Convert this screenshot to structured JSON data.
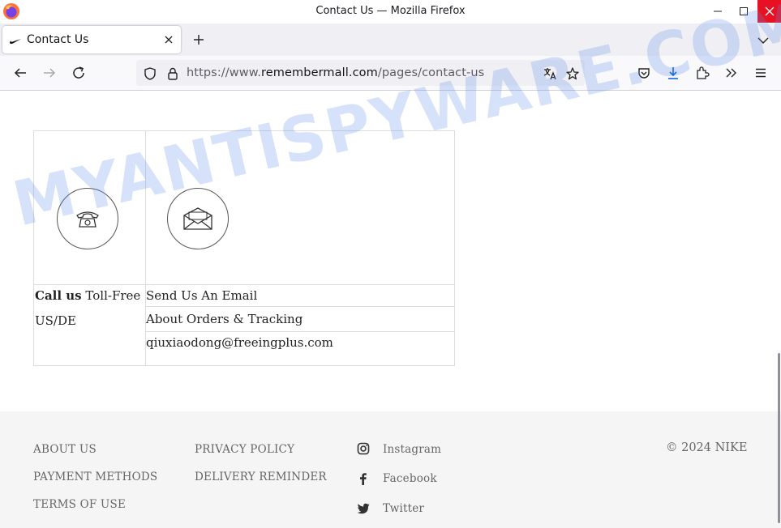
{
  "window": {
    "title": "Contact Us — Mozilla Firefox"
  },
  "tab": {
    "label": "Contact Us"
  },
  "urlbar": {
    "prefix": "https://www.",
    "domain": "remembermall.com",
    "path": "/pages/contact-us"
  },
  "contact": {
    "call_bold": "Call us",
    "call_rest": " Toll-Free",
    "region": "US/DE",
    "email_heading": "Send Us An Email",
    "orders": "About Orders & Tracking",
    "email": "qiuxiaodong@freeingplus.com"
  },
  "footer": {
    "col1": [
      "ABOUT US",
      "PAYMENT METHODS",
      "TERMS OF USE"
    ],
    "col2": [
      "PRIVACY POLICY",
      "DELIVERY REMINDER"
    ],
    "social": [
      {
        "label": "Instagram",
        "icon": "instagram-icon"
      },
      {
        "label": "Facebook",
        "icon": "facebook-icon"
      },
      {
        "label": "Twitter",
        "icon": "twitter-icon"
      }
    ],
    "copyright": "© 2024 NIKE"
  },
  "watermark": "MYANTISPYWARE.COM",
  "colors": {
    "close_button": "#e81123",
    "download_accent": "#0061e0",
    "watermark": "#5a8ce6"
  }
}
